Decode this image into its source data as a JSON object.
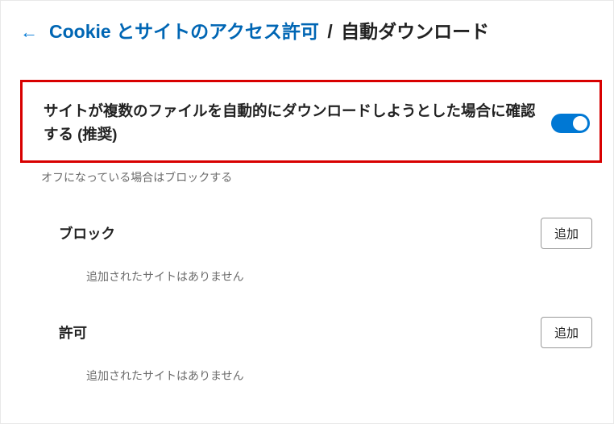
{
  "header": {
    "breadcrumb_link": "Cookie とサイトのアクセス許可",
    "breadcrumb_separator": "/",
    "breadcrumb_current": "自動ダウンロード"
  },
  "toggle": {
    "title": "サイトが複数のファイルを自動的にダウンロードしようとした場合に確認する (推奨)",
    "subtitle": "オフになっている場合はブロックする",
    "state": "on"
  },
  "sections": {
    "block": {
      "title": "ブロック",
      "add_label": "追加",
      "empty": "追加されたサイトはありません"
    },
    "allow": {
      "title": "許可",
      "add_label": "追加",
      "empty": "追加されたサイトはありません"
    }
  }
}
